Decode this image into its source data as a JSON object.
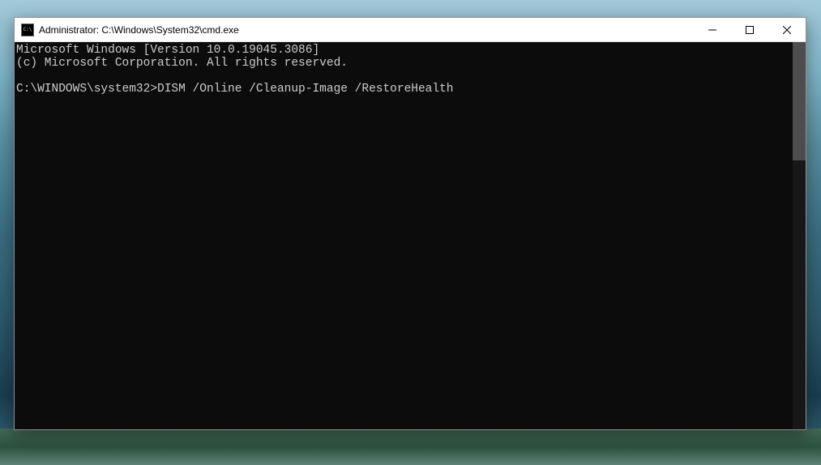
{
  "window": {
    "title": "Administrator: C:\\Windows\\System32\\cmd.exe"
  },
  "terminal": {
    "line1": "Microsoft Windows [Version 10.0.19045.3086]",
    "line2": "(c) Microsoft Corporation. All rights reserved.",
    "blank": "",
    "prompt": "C:\\WINDOWS\\system32>",
    "command": "DISM /Online /Cleanup-Image /RestoreHealth"
  }
}
